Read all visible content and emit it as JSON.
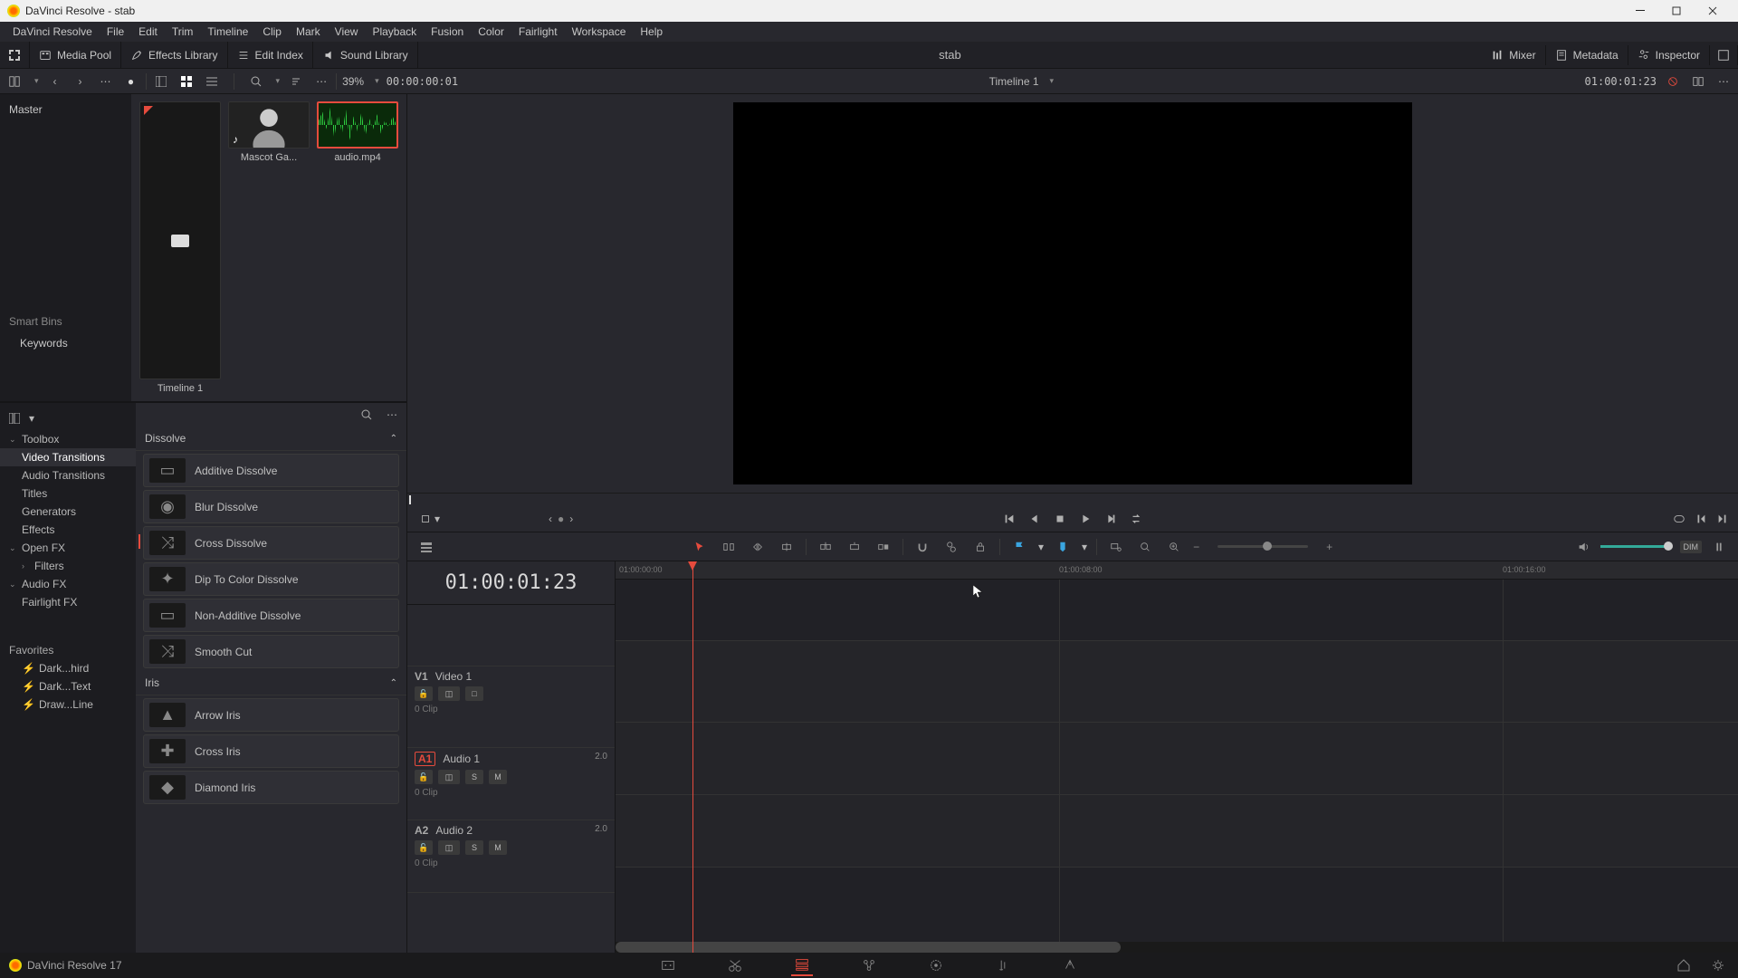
{
  "titlebar": {
    "text": "DaVinci Resolve - stab"
  },
  "menus": [
    "DaVinci Resolve",
    "File",
    "Edit",
    "Trim",
    "Timeline",
    "Clip",
    "Mark",
    "View",
    "Playback",
    "Fusion",
    "Color",
    "Fairlight",
    "Workspace",
    "Help"
  ],
  "toptoolbar": {
    "media_pool": "Media Pool",
    "effects_library": "Effects Library",
    "edit_index": "Edit Index",
    "sound_library": "Sound Library",
    "project": "stab",
    "mixer": "Mixer",
    "metadata": "Metadata",
    "inspector": "Inspector"
  },
  "sectoolbar": {
    "zoom": "39%",
    "source_tc": "00:00:00:01",
    "timeline_name": "Timeline 1",
    "record_tc": "01:00:01:23"
  },
  "bins": {
    "master": "Master",
    "smart": "Smart Bins",
    "keywords": "Keywords"
  },
  "clips": [
    {
      "name": "Timeline 1",
      "kind": "timeline"
    },
    {
      "name": "Mascot Ga...",
      "kind": "video"
    },
    {
      "name": "audio.mp4",
      "kind": "audio",
      "selected": true
    }
  ],
  "fx_tree": {
    "toolbox": "Toolbox",
    "video_transitions": "Video Transitions",
    "audio_transitions": "Audio Transitions",
    "titles": "Titles",
    "generators": "Generators",
    "effects": "Effects",
    "openfx": "Open FX",
    "filters": "Filters",
    "audiofx": "Audio FX",
    "fairlightfx": "Fairlight FX",
    "favorites": "Favorites",
    "fav_items": [
      "Dark...hird",
      "Dark...Text",
      "Draw...Line"
    ]
  },
  "fx_list": {
    "cat_dissolve": "Dissolve",
    "dissolves": [
      "Additive Dissolve",
      "Blur Dissolve",
      "Cross Dissolve",
      "Dip To Color Dissolve",
      "Non-Additive Dissolve",
      "Smooth Cut"
    ],
    "cat_iris": "Iris",
    "iris": [
      "Arrow Iris",
      "Cross Iris",
      "Diamond Iris"
    ]
  },
  "timeline": {
    "tc": "01:00:01:23",
    "ruler": [
      "01:00:00:00",
      "01:00:08:00",
      "01:00:16:00"
    ],
    "tracks": {
      "v1": {
        "id": "V1",
        "name": "Video 1",
        "clip_count": "0 Clip"
      },
      "a1": {
        "id": "A1",
        "name": "Audio 1",
        "ch": "2.0",
        "clip_count": "0 Clip"
      },
      "a2": {
        "id": "A2",
        "name": "Audio 2",
        "ch": "2.0",
        "clip_count": "0 Clip"
      }
    },
    "dim": "DIM"
  },
  "pagebar": {
    "app": "DaVinci Resolve 17"
  }
}
